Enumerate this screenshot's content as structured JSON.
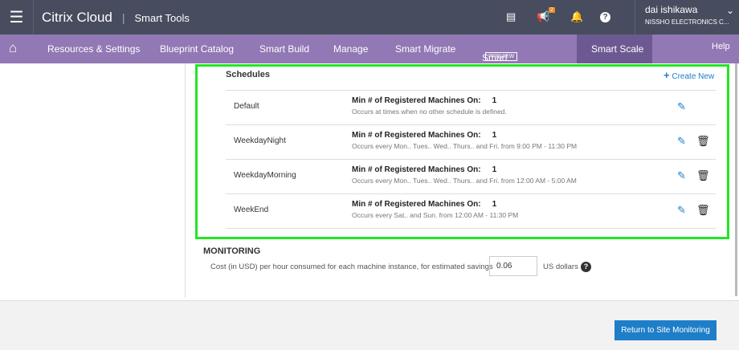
{
  "header": {
    "brand": "Citrix Cloud",
    "product": "Smart Tools",
    "notification_count": "2",
    "user_name": "dai ishikawa",
    "company": "NISSHO ELECTRONICS C..."
  },
  "nav": {
    "items": [
      "Resources & Settings",
      "Blueprint Catalog",
      "Smart Build",
      "Manage",
      "Smart Migrate",
      "Smart Check",
      "Smart Scale"
    ],
    "preview_badge": "PREVIEW",
    "help": "Help"
  },
  "schedules": {
    "title": "Schedules",
    "create_new": "Create New",
    "rows": [
      {
        "name": "Default",
        "label": "Min # of Registered Machines On:",
        "value": "1",
        "desc": "Occurs at times when no other schedule is defined.",
        "deletable": false
      },
      {
        "name": "WeekdayNight",
        "label": "Min # of Registered Machines On:",
        "value": "1",
        "desc": "Occurs every Mon.. Tues.. Wed.. Thurs.. and Fri. from 9:00 PM - 11:30 PM",
        "deletable": true
      },
      {
        "name": "WeekdayMorning",
        "label": "Min # of Registered Machines On:",
        "value": "1",
        "desc": "Occurs every Mon.. Tues.. Wed.. Thurs.. and Fri. from 12:00 AM - 5:00 AM",
        "deletable": true
      },
      {
        "name": "WeekEnd",
        "label": "Min # of Registered Machines On:",
        "value": "1",
        "desc": "Occurs every Sat.. and Sun. from 12:00 AM - 11:30 PM",
        "deletable": true
      }
    ]
  },
  "monitoring": {
    "title": "MONITORING",
    "cost_label": "Cost (in USD) per hour consumed for each machine instance, for estimated savings",
    "cost_value": "0.06",
    "unit": "US dollars"
  },
  "footer": {
    "return_button": "Return to Site Monitoring"
  }
}
